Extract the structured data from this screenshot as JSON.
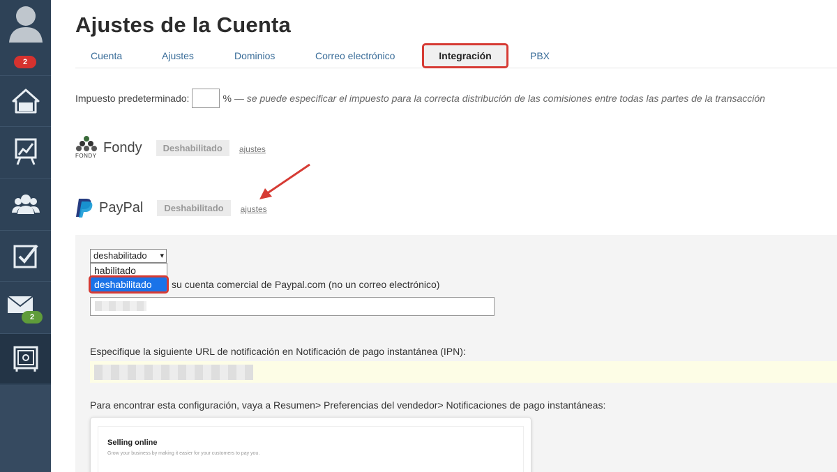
{
  "sidebar": {
    "notifications_count": "2",
    "mail_count": "2"
  },
  "header": {
    "title": "Ajustes de la Cuenta"
  },
  "tabs": [
    {
      "label": "Cuenta"
    },
    {
      "label": "Ajustes"
    },
    {
      "label": "Dominios"
    },
    {
      "label": "Correo electrónico"
    },
    {
      "label": "Integración",
      "active": true
    },
    {
      "label": "PBX"
    }
  ],
  "tax": {
    "label": "Impuesto predeterminado:",
    "unit": "%",
    "hint": "— se puede especificar el impuesto para la correcta distribución de las comisiones entre todas las partes de la transacción"
  },
  "gateways": {
    "fondy": {
      "logo_text": "FONDY",
      "name": "Fondy",
      "status": "Deshabilitado",
      "link": "ajustes"
    },
    "paypal": {
      "name": "PayPal",
      "status": "Deshabilitado",
      "link": "ajustes"
    }
  },
  "paypal_panel": {
    "select_value": "deshabilitado",
    "options": [
      "habilitado",
      "deshabilitado"
    ],
    "account_label": "su cuenta comercial de Paypal.com (no un correo electrónico)",
    "ipn_label": "Especifique la siguiente URL de notificación en Notificación de pago instantánea (IPN):",
    "find_label": "Para encontrar esta configuración, vaya a Resumen> Preferencias del vendedor> Notificaciones de pago instantáneas:",
    "screenshot": {
      "title": "Selling online",
      "subtitle": "Grow your business by making it easier for your customers to pay you."
    }
  },
  "colors": {
    "sidebar": "#2e4257",
    "accent_red": "#d63b34",
    "link_blue": "#3a6d99",
    "select_blue": "#1a73e8"
  }
}
